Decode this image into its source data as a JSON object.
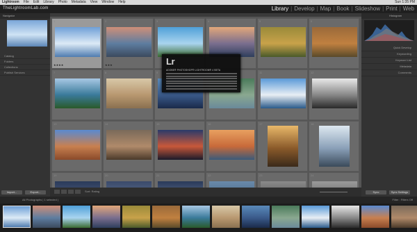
{
  "menubar": {
    "items": [
      "Lightroom",
      "File",
      "Edit",
      "Library",
      "Photo",
      "Metadata",
      "View",
      "Window",
      "Help"
    ],
    "clock": "Sun 1:35 PM"
  },
  "brand": "TheLightroomLab.com",
  "modules": [
    {
      "label": "Library",
      "active": true
    },
    {
      "label": "Develop",
      "active": false
    },
    {
      "label": "Map",
      "active": false
    },
    {
      "label": "Book",
      "active": false
    },
    {
      "label": "Slideshow",
      "active": false
    },
    {
      "label": "Print",
      "active": false
    },
    {
      "label": "Web",
      "active": false
    }
  ],
  "left_panel": {
    "navigator": "Navigator",
    "sections": [
      "Catalog",
      "Folders",
      "Collections",
      "Publish Services"
    ],
    "import_label": "Import...",
    "export_label": "Export..."
  },
  "right_panel": {
    "histogram": "Histogram",
    "sections": [
      "Quick Develop",
      "Keywording",
      "Keyword List",
      "Metadata",
      "Comments"
    ],
    "sync_label": "Sync",
    "sync_settings_label": "Sync Settings"
  },
  "splash": {
    "logo": "Lr",
    "product": "ADOBE® PHOTOSHOP® LIGHTROOM® 4 BETA"
  },
  "toolbar": {
    "sort_label": "Sort:",
    "sort_value": "Rating"
  },
  "filmstrip": {
    "count": "All Photographs  |  1 selected  |  ",
    "filter_label": "Filter :",
    "filter_value": "Filters Off"
  },
  "grid": [
    {
      "num": "1",
      "stars": "★★★★",
      "colors": [
        "#6e9fd6",
        "#dceaf6",
        "#4f7cb0"
      ],
      "selected": true
    },
    {
      "num": "2",
      "stars": "★★★",
      "colors": [
        "#cf8f78",
        "#5e7da0",
        "#3b4a5e"
      ]
    },
    {
      "num": "3",
      "stars": "",
      "colors": [
        "#4fa0d8",
        "#a9d4ef",
        "#3a6a30"
      ]
    },
    {
      "num": "4",
      "stars": "",
      "colors": [
        "#e2a77a",
        "#7a6e8e",
        "#2e3e5c"
      ]
    },
    {
      "num": "5",
      "stars": "",
      "colors": [
        "#9a8a3a",
        "#c8a24a",
        "#4a5a2a"
      ]
    },
    {
      "num": "6",
      "stars": "",
      "colors": [
        "#9a6a3a",
        "#c08040",
        "#5a4a2a"
      ]
    },
    {
      "num": "7",
      "stars": "",
      "colors": [
        "#a8c8e4",
        "#3a7a9a",
        "#2a5a2a"
      ]
    },
    {
      "num": "8",
      "stars": "",
      "colors": [
        "#d8c8a8",
        "#b89870",
        "#8a7050"
      ]
    },
    {
      "num": "9",
      "stars": "",
      "colors": [
        "#5a8aba",
        "#3a5a8a",
        "#1a2a4a"
      ]
    },
    {
      "num": "10",
      "stars": "",
      "colors": [
        "#4a7a5a",
        "#8aa890",
        "#6a8a9a"
      ]
    },
    {
      "num": "11",
      "stars": "",
      "colors": [
        "#5a9ad8",
        "#e8eef4",
        "#2a5a8a"
      ]
    },
    {
      "num": "12",
      "stars": "",
      "colors": [
        "#e8e8e8",
        "#888888",
        "#2a2a2a"
      ]
    },
    {
      "num": "13",
      "stars": "",
      "colors": [
        "#5a8ad0",
        "#c88050",
        "#8a4a2a"
      ]
    },
    {
      "num": "14",
      "stars": "",
      "colors": [
        "#7a6a5a",
        "#b08a6a",
        "#4a3a2a"
      ]
    },
    {
      "num": "15",
      "stars": "",
      "colors": [
        "#2a3a6a",
        "#c8583a",
        "#1a1a2a"
      ]
    },
    {
      "num": "16",
      "stars": "",
      "colors": [
        "#e8a060",
        "#c86a3a",
        "#3a5a7a"
      ]
    },
    {
      "num": "17",
      "stars": "",
      "colors": [
        "#e8b86a",
        "#8a5a2a",
        "#3a2a1a"
      ],
      "tall": true
    },
    {
      "num": "18",
      "stars": "",
      "colors": [
        "#dde8f0",
        "#8aa0b8",
        "#3a4a5a"
      ],
      "tall": true
    },
    {
      "num": "19",
      "stars": "",
      "colors": [
        "#2a3a5a",
        "#4a5a7a",
        "#6a7a9a"
      ]
    },
    {
      "num": "20",
      "stars": "",
      "colors": [
        "#3a4a6a",
        "#5a6a8a",
        "#8a9aba"
      ]
    },
    {
      "num": "21",
      "stars": "",
      "colors": [
        "#2a3a5a",
        "#5a6a8a",
        "#9aaaca"
      ]
    },
    {
      "num": "22",
      "stars": "",
      "colors": [
        "#6a8aaa",
        "#4a6a8a",
        "#2a4a6a"
      ]
    },
    {
      "num": "23",
      "stars": "",
      "colors": [
        "#8a8a8a",
        "#5a5a5a",
        "#3a3a3a"
      ]
    },
    {
      "num": "24",
      "stars": "",
      "colors": [
        "#9a9a9a",
        "#6a6a6a",
        "#3a3a3a"
      ]
    }
  ],
  "film": [
    {
      "colors": [
        "#6e9fd6",
        "#dceaf6",
        "#4f7cb0"
      ],
      "selected": true
    },
    {
      "colors": [
        "#cf8f78",
        "#5e7da0",
        "#3b4a5e"
      ]
    },
    {
      "colors": [
        "#4fa0d8",
        "#a9d4ef",
        "#3a6a30"
      ]
    },
    {
      "colors": [
        "#e2a77a",
        "#7a6e8e",
        "#2e3e5c"
      ]
    },
    {
      "colors": [
        "#9a8a3a",
        "#c8a24a",
        "#4a5a2a"
      ]
    },
    {
      "colors": [
        "#9a6a3a",
        "#c08040",
        "#5a4a2a"
      ]
    },
    {
      "colors": [
        "#a8c8e4",
        "#3a7a9a",
        "#2a5a2a"
      ]
    },
    {
      "colors": [
        "#d8c8a8",
        "#b89870",
        "#8a7050"
      ]
    },
    {
      "colors": [
        "#5a8aba",
        "#3a5a8a",
        "#1a2a4a"
      ]
    },
    {
      "colors": [
        "#4a7a5a",
        "#8aa890",
        "#6a8a9a"
      ]
    },
    {
      "colors": [
        "#5a9ad8",
        "#e8eef4",
        "#2a5a8a"
      ]
    },
    {
      "colors": [
        "#e8e8e8",
        "#888888",
        "#2a2a2a"
      ]
    },
    {
      "colors": [
        "#5a8ad0",
        "#c88050",
        "#8a4a2a"
      ]
    },
    {
      "colors": [
        "#7a6a5a",
        "#b08a6a",
        "#4a3a2a"
      ]
    }
  ]
}
